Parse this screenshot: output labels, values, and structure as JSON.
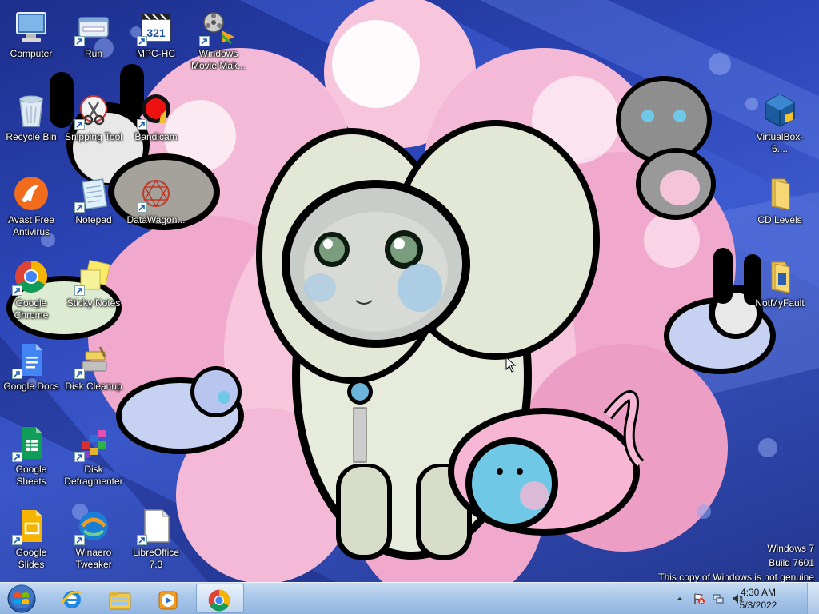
{
  "desktop_icons": [
    {
      "id": "computer",
      "label": "Computer",
      "icon": "computer-icon",
      "shortcut": false
    },
    {
      "id": "run",
      "label": "Run",
      "icon": "run-icon",
      "shortcut": true
    },
    {
      "id": "mpc-hc",
      "label": "MPC-HC",
      "icon": "mpc-hc-icon",
      "shortcut": true
    },
    {
      "id": "movie-maker",
      "label": "Windows Movie Mak...",
      "icon": "movie-maker-icon",
      "shortcut": true
    },
    {
      "id": "recycle-bin",
      "label": "Recycle Bin",
      "icon": "recycle-bin-icon",
      "shortcut": false
    },
    {
      "id": "snipping-tool",
      "label": "Snipping Tool",
      "icon": "snipping-tool-icon",
      "shortcut": true
    },
    {
      "id": "bandicam",
      "label": "Bandicam",
      "icon": "bandicam-icon",
      "shortcut": true
    },
    {
      "id": "virtualbox",
      "label": "VirtualBox-6....",
      "icon": "virtualbox-icon",
      "shortcut": false
    },
    {
      "id": "avast",
      "label": "Avast Free Antivirus",
      "icon": "avast-icon",
      "shortcut": false
    },
    {
      "id": "notepad",
      "label": "Notepad",
      "icon": "notepad-icon",
      "shortcut": true
    },
    {
      "id": "datawagon",
      "label": "DataWagon...",
      "icon": "datawagon-icon",
      "shortcut": true
    },
    {
      "id": "cd-levels",
      "label": "CD Levels",
      "icon": "folder-icon",
      "shortcut": false
    },
    {
      "id": "chrome",
      "label": "Google Chrome",
      "icon": "chrome-icon",
      "shortcut": true
    },
    {
      "id": "sticky-notes",
      "label": "Sticky Notes",
      "icon": "sticky-notes-icon",
      "shortcut": true
    },
    {
      "id": "notmyfault",
      "label": "NotMyFault",
      "icon": "notmyfault-icon",
      "shortcut": false
    },
    {
      "id": "google-docs",
      "label": "Google Docs",
      "icon": "google-docs-icon",
      "shortcut": true
    },
    {
      "id": "disk-cleanup",
      "label": "Disk Cleanup",
      "icon": "disk-cleanup-icon",
      "shortcut": true
    },
    {
      "id": "google-sheets",
      "label": "Google Sheets",
      "icon": "google-sheets-icon",
      "shortcut": true
    },
    {
      "id": "disk-defrag",
      "label": "Disk Defragmenter",
      "icon": "disk-defragmenter-icon",
      "shortcut": true
    },
    {
      "id": "google-slides",
      "label": "Google Slides",
      "icon": "google-slides-icon",
      "shortcut": true
    },
    {
      "id": "winaero",
      "label": "Winaero Tweaker",
      "icon": "winaero-tweaker-icon",
      "shortcut": true
    },
    {
      "id": "libreoffice",
      "label": "LibreOffice 7.3",
      "icon": "libreoffice-icon",
      "shortcut": true
    }
  ],
  "watermark": {
    "line1": "Windows 7",
    "line2": "Build 7601",
    "line3": "This copy of Windows is not genuine"
  },
  "taskbar": {
    "start_icon": "windows-start-icon",
    "pinned": [
      {
        "id": "ie",
        "icon": "internet-explorer-icon",
        "active": false
      },
      {
        "id": "explorer",
        "icon": "file-explorer-icon",
        "active": false
      },
      {
        "id": "media-player",
        "icon": "media-player-icon",
        "active": false
      },
      {
        "id": "chrome",
        "icon": "chrome-icon",
        "active": true
      }
    ],
    "tray_icons": [
      "show-hidden-icons-icon",
      "action-center-flag-icon",
      "network-icon",
      "volume-icon"
    ],
    "clock": {
      "time": "4:30 AM",
      "date": "5/3/2022"
    }
  },
  "colors": {
    "taskbar": "#a9c7ea",
    "wallpaper_blue": "#2c46b8",
    "wallpaper_pink": "#f4b9d6"
  }
}
